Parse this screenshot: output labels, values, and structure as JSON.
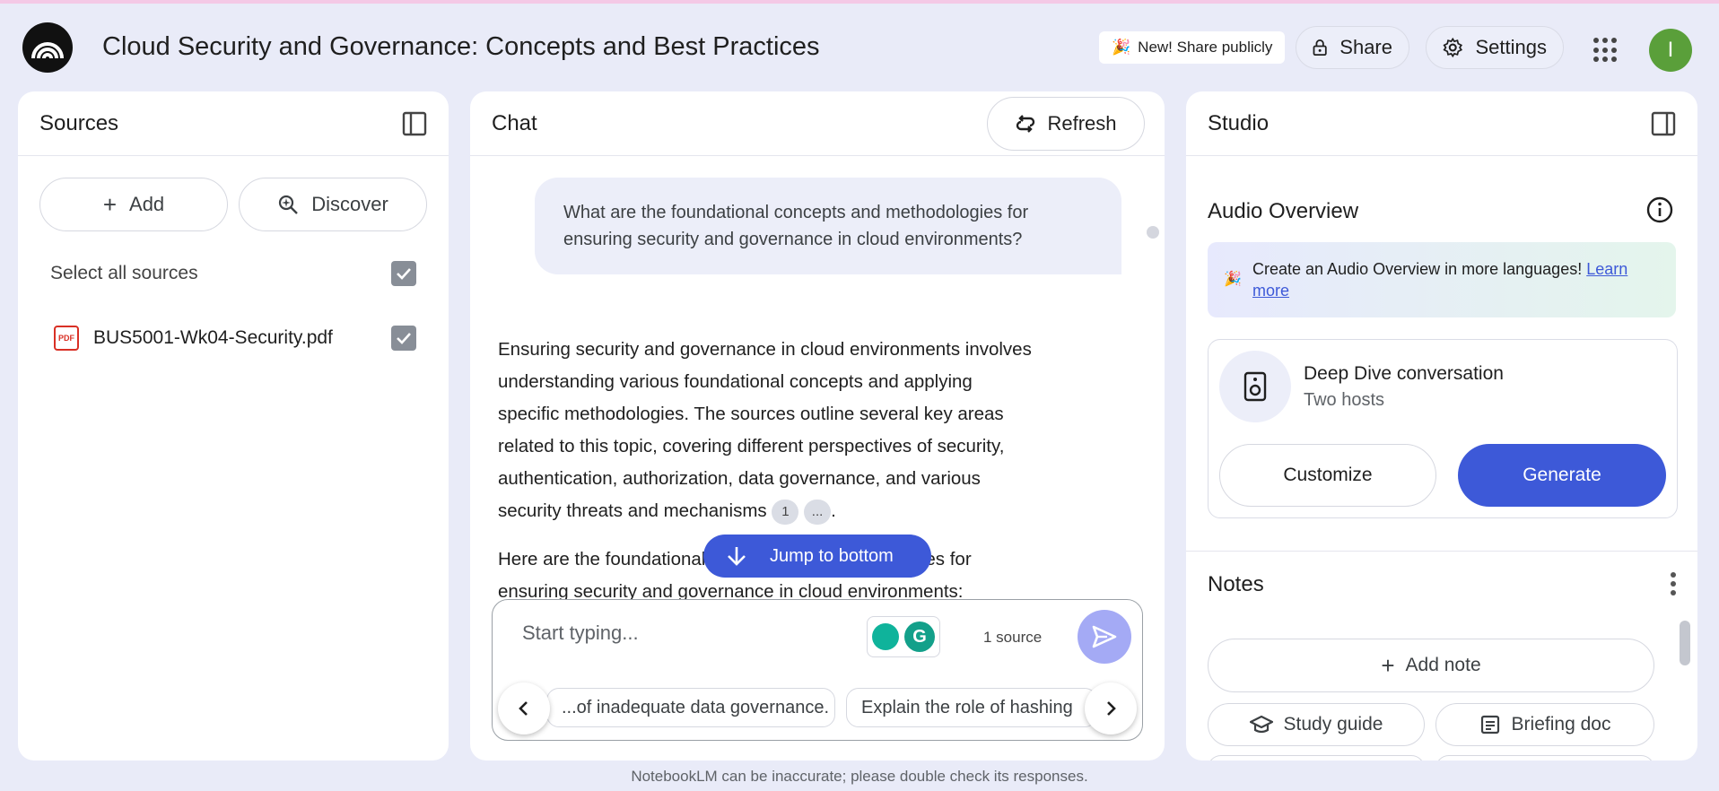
{
  "header": {
    "title": "Cloud Security and Governance: Concepts and Best Practices",
    "share_publicly_label": "New! Share publicly",
    "share_label": "Share",
    "settings_label": "Settings",
    "avatar_initial": "I"
  },
  "sources": {
    "title": "Sources",
    "add_label": "Add",
    "discover_label": "Discover",
    "select_all_label": "Select all sources",
    "files": [
      {
        "name": "BUS5001-Wk04-Security.pdf",
        "icon": "pdf-icon",
        "checked": true
      }
    ]
  },
  "chat": {
    "title": "Chat",
    "refresh_label": "Refresh",
    "question": "What are the foundational concepts and methodologies for ensuring security and governance in cloud environments?",
    "answer_paragraph": "Ensuring security and governance in cloud environments involves understanding various foundational concepts and applying specific methodologies. The sources outline several key areas related to this topic, covering different perspectives of security, authentication, authorization, data governance, and various security threats and mechanisms",
    "citation_1": "1",
    "citation_more": "...",
    "answer_paragraph_2": "Here are the foundational concepts and methodologies for ensuring security and governance in cloud environments:",
    "jump_label": "Jump to bottom",
    "input_placeholder": "Start typing...",
    "source_count": "1 source",
    "suggestions": [
      "...of inadequate data governance.",
      "Explain the role of hashing"
    ]
  },
  "studio": {
    "title": "Studio",
    "audio_overview_title": "Audio Overview",
    "banner_text": "Create an Audio Overview in more languages!",
    "banner_link": "Learn more",
    "deep_dive_title": "Deep Dive conversation",
    "deep_dive_subtitle": "Two hosts",
    "customize_label": "Customize",
    "generate_label": "Generate",
    "notes_title": "Notes",
    "add_note_label": "Add note",
    "chips": [
      "Study guide",
      "Briefing doc"
    ]
  },
  "footer": {
    "disclaimer": "NotebookLM can be inaccurate; please double check its responses."
  },
  "colors": {
    "accent": "#3d59d8",
    "background": "#e9ebf8",
    "avatar": "#5a9f3a"
  }
}
